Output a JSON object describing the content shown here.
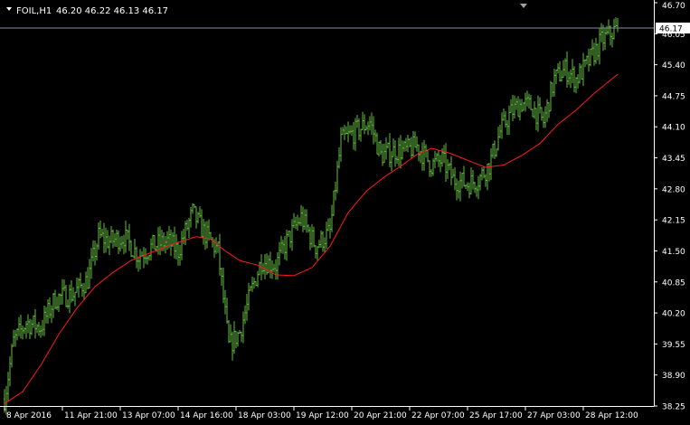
{
  "header": {
    "symbol": "FOIL,H1",
    "ohlc": "46.20 46.22 46.13 46.17"
  },
  "colors": {
    "background": "#000000",
    "axis": "#ffffff",
    "text": "#ffffff",
    "bar": "#66bb44",
    "ma": "#ff1a1a",
    "price_line": "#7a8fa8",
    "price_label_bg": "#ffffff",
    "price_label_text": "#000000"
  },
  "chart_data": {
    "type": "ohlc",
    "title": "FOIL,H1",
    "current_price": 46.17,
    "ylim": [
      38.25,
      46.7
    ],
    "y_ticks": [
      {
        "value": 46.7,
        "label": "46.70"
      },
      {
        "value": 46.05,
        "label": "46.05"
      },
      {
        "value": 45.4,
        "label": "45.40"
      },
      {
        "value": 44.75,
        "label": "44.75"
      },
      {
        "value": 44.1,
        "label": "44.10"
      },
      {
        "value": 43.45,
        "label": "43.45"
      },
      {
        "value": 42.8,
        "label": "42.80"
      },
      {
        "value": 42.15,
        "label": "42.15"
      },
      {
        "value": 41.5,
        "label": "41.50"
      },
      {
        "value": 40.85,
        "label": "40.85"
      },
      {
        "value": 40.2,
        "label": "40.20"
      },
      {
        "value": 39.55,
        "label": "39.55"
      },
      {
        "value": 38.9,
        "label": "38.90"
      },
      {
        "value": 38.25,
        "label": "38.25"
      }
    ],
    "x_ticks": [
      {
        "index": 0,
        "label": "8 Apr 2016"
      },
      {
        "index": 32,
        "label": "11 Apr 21:00"
      },
      {
        "index": 64,
        "label": "13 Apr 07:00"
      },
      {
        "index": 96,
        "label": "14 Apr 16:00"
      },
      {
        "index": 128,
        "label": "18 Apr 03:00"
      },
      {
        "index": 160,
        "label": "19 Apr 12:00"
      },
      {
        "index": 192,
        "label": "20 Apr 21:00"
      },
      {
        "index": 224,
        "label": "22 Apr 07:00"
      },
      {
        "index": 256,
        "label": "25 Apr 17:00"
      },
      {
        "index": 288,
        "label": "27 Apr 03:00"
      },
      {
        "index": 320,
        "label": "28 Apr 12:00"
      }
    ],
    "bar_count": 340,
    "close_anchors": [
      [
        0,
        38.4
      ],
      [
        5,
        39.6
      ],
      [
        12,
        40.0
      ],
      [
        20,
        39.9
      ],
      [
        28,
        40.5
      ],
      [
        38,
        40.6
      ],
      [
        46,
        40.9
      ],
      [
        52,
        41.8
      ],
      [
        58,
        41.7
      ],
      [
        66,
        41.8
      ],
      [
        74,
        41.4
      ],
      [
        82,
        41.6
      ],
      [
        90,
        41.7
      ],
      [
        96,
        41.5
      ],
      [
        104,
        42.3
      ],
      [
        110,
        41.9
      ],
      [
        118,
        41.5
      ],
      [
        124,
        39.5
      ],
      [
        130,
        39.8
      ],
      [
        136,
        40.6
      ],
      [
        142,
        41.3
      ],
      [
        150,
        41.2
      ],
      [
        156,
        41.7
      ],
      [
        164,
        42.2
      ],
      [
        172,
        41.6
      ],
      [
        180,
        41.9
      ],
      [
        186,
        43.8
      ],
      [
        194,
        44.0
      ],
      [
        202,
        44.2
      ],
      [
        208,
        43.5
      ],
      [
        216,
        43.6
      ],
      [
        222,
        43.6
      ],
      [
        228,
        43.7
      ],
      [
        236,
        43.3
      ],
      [
        242,
        43.4
      ],
      [
        248,
        43.0
      ],
      [
        256,
        42.9
      ],
      [
        262,
        43.0
      ],
      [
        268,
        43.3
      ],
      [
        274,
        44.0
      ],
      [
        280,
        44.4
      ],
      [
        286,
        44.6
      ],
      [
        292,
        44.5
      ],
      [
        298,
        44.2
      ],
      [
        304,
        45.1
      ],
      [
        310,
        45.3
      ],
      [
        316,
        45.1
      ],
      [
        322,
        45.4
      ],
      [
        330,
        45.9
      ],
      [
        339,
        46.17
      ]
    ],
    "ma_anchors": [
      [
        0,
        38.3
      ],
      [
        10,
        38.55
      ],
      [
        20,
        39.1
      ],
      [
        30,
        39.75
      ],
      [
        40,
        40.3
      ],
      [
        50,
        40.75
      ],
      [
        60,
        41.05
      ],
      [
        70,
        41.3
      ],
      [
        80,
        41.45
      ],
      [
        90,
        41.6
      ],
      [
        98,
        41.7
      ],
      [
        106,
        41.8
      ],
      [
        114,
        41.75
      ],
      [
        122,
        41.5
      ],
      [
        130,
        41.3
      ],
      [
        140,
        41.2
      ],
      [
        150,
        41.0
      ],
      [
        160,
        40.98
      ],
      [
        170,
        41.15
      ],
      [
        180,
        41.6
      ],
      [
        190,
        42.3
      ],
      [
        200,
        42.75
      ],
      [
        210,
        43.05
      ],
      [
        220,
        43.3
      ],
      [
        228,
        43.52
      ],
      [
        236,
        43.65
      ],
      [
        246,
        43.55
      ],
      [
        256,
        43.4
      ],
      [
        266,
        43.25
      ],
      [
        276,
        43.3
      ],
      [
        286,
        43.5
      ],
      [
        296,
        43.75
      ],
      [
        306,
        44.15
      ],
      [
        316,
        44.45
      ],
      [
        326,
        44.8
      ],
      [
        339,
        45.2
      ]
    ]
  }
}
